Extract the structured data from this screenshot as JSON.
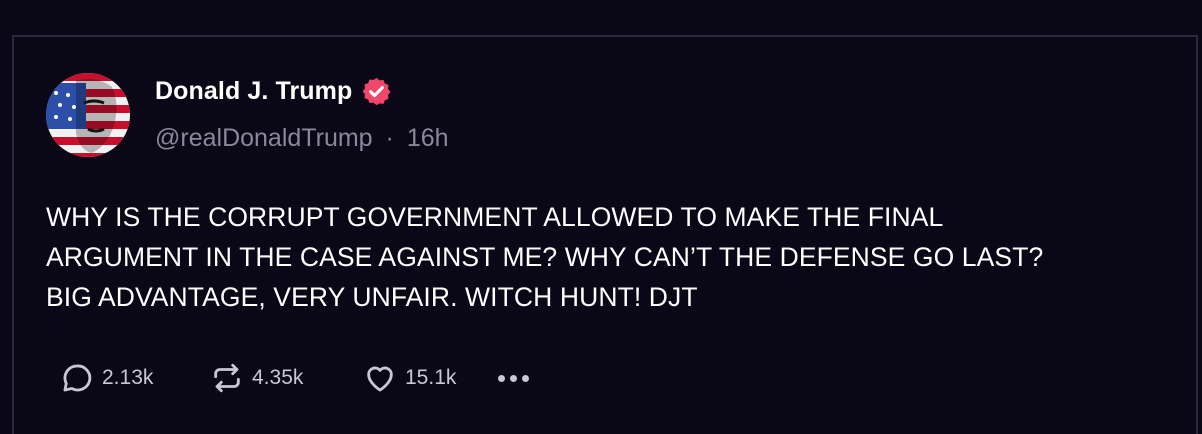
{
  "post": {
    "author": {
      "display_name": "Donald J. Trump",
      "handle": "@realDonaldTrump",
      "separator": "·",
      "time_ago": "16h",
      "verified": true
    },
    "text_lines": [
      "WHY IS THE CORRUPT GOVERNMENT ALLOWED TO MAKE THE FINAL",
      "ARGUMENT IN THE CASE AGAINST ME? WHY CAN’T THE DEFENSE GO LAST?",
      "BIG ADVANTAGE, VERY UNFAIR. WITCH HUNT! DJT"
    ],
    "actions": {
      "reply_count": "2.13k",
      "repost_count": "4.35k",
      "like_count": "15.1k"
    }
  },
  "colors": {
    "background": "#0a0717",
    "verified_badge": "#f0476a",
    "secondary_text": "#8a8899",
    "icon": "#c9c7d6"
  },
  "icons": {
    "reply": "speech-bubble-icon",
    "repost": "repost-arrows-icon",
    "like": "heart-icon",
    "more": "ellipsis-icon",
    "verified": "verified-badge-icon"
  }
}
